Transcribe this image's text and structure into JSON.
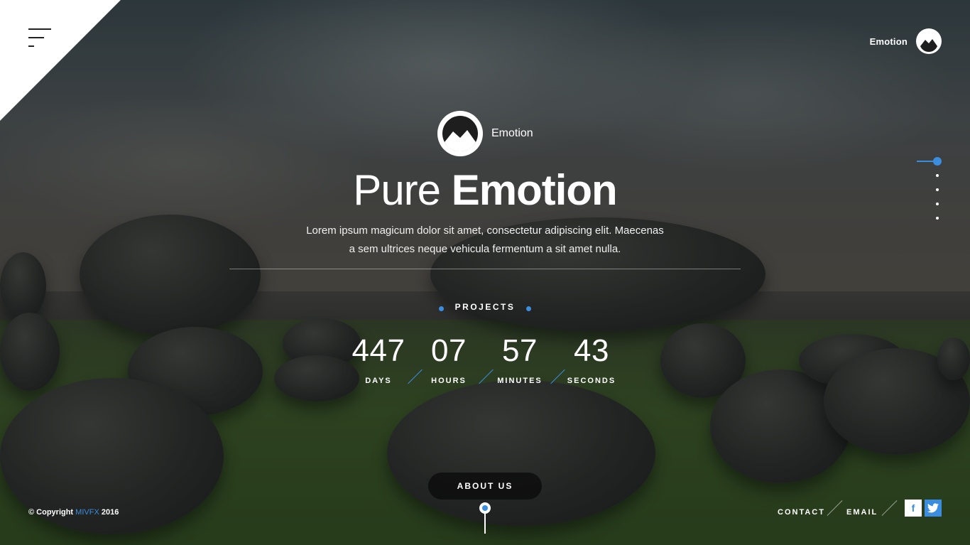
{
  "header": {
    "brand_name": "Emotion",
    "menu_icon": "hamburger-menu-icon",
    "logo_icon": "mountain-logo-icon"
  },
  "hero": {
    "brand_name": "Emotion",
    "title_light": "Pure",
    "title_bold": "Emotion",
    "description_line1": "Lorem ipsum magicum dolor sit amet, consectetur adipiscing elit. Maecenas",
    "description_line2": "a sem ultrices neque vehicula fermentum a sit amet nulla."
  },
  "countdown": {
    "heading": "PROJECTS",
    "items": [
      {
        "value": "447",
        "label": "DAYS"
      },
      {
        "value": "07",
        "label": "HOURS"
      },
      {
        "value": "57",
        "label": "MINUTES"
      },
      {
        "value": "43",
        "label": "SECONDS"
      }
    ]
  },
  "pager": {
    "active_index": 0,
    "count": 5
  },
  "footer": {
    "about_button": "ABOUT US",
    "copyright_prefix": "© Copyright",
    "copyright_brand": "MIVFX",
    "copyright_year": "2016",
    "links": [
      "CONTACT",
      "EMAIL"
    ],
    "social": [
      {
        "name": "facebook-icon",
        "glyph": "f"
      },
      {
        "name": "twitter-icon",
        "glyph": "t"
      }
    ]
  },
  "colors": {
    "accent": "#3b8de0",
    "text": "#ffffff",
    "corner": "#ffffff"
  }
}
